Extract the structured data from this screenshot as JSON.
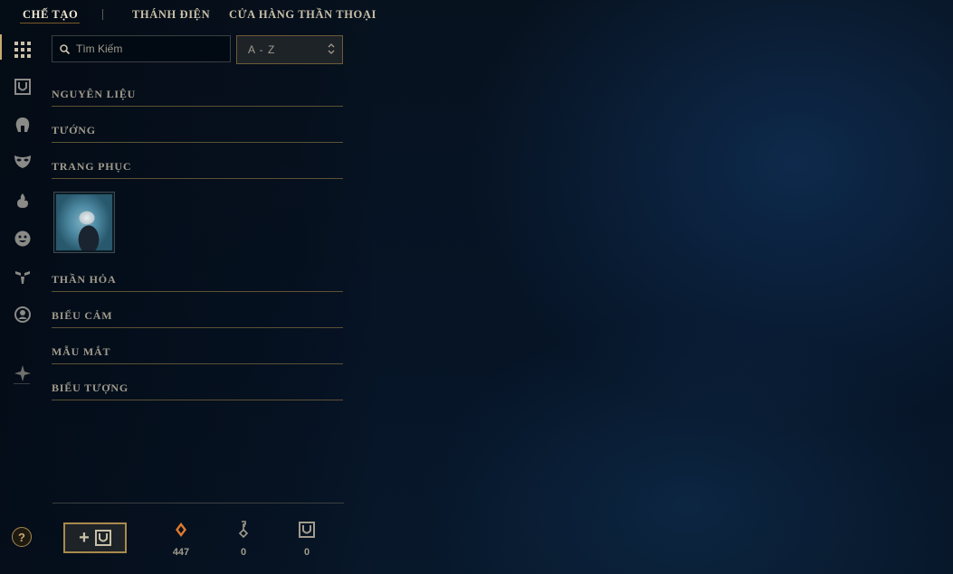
{
  "nav": {
    "tabs": [
      {
        "label": "CHẾ TẠO"
      },
      {
        "label": "THÁNH ĐIỆN"
      },
      {
        "label": "CỬA HÀNG THẦN THOẠI"
      }
    ]
  },
  "rail": {
    "icons": [
      "grid-icon",
      "chest-icon",
      "champion-helmet-icon",
      "skin-mask-icon",
      "ward-flame-icon",
      "emote-face-icon",
      "eternals-icon",
      "profile-icon",
      "summoner-icon"
    ]
  },
  "search": {
    "placeholder": "Tìm Kiếm",
    "value": ""
  },
  "sort": {
    "value": "A - Z"
  },
  "categories": [
    {
      "label": "NGUYÊN LIỆU"
    },
    {
      "label": "TƯỚNG"
    },
    {
      "label": "TRANG PHỤC"
    },
    {
      "label": "THẦN HỎA"
    },
    {
      "label": "BIỂU CẢM"
    },
    {
      "label": "MẪU MẮT"
    },
    {
      "label": "BIỂU TƯỢNG"
    }
  ],
  "bottom": {
    "help_label": "?",
    "add_label": "+",
    "currencies": [
      {
        "icon": "orange-essence-icon",
        "value": "447",
        "color": "#e07a2c"
      },
      {
        "icon": "key-fragment-icon",
        "value": "0",
        "color": "#a09b8c"
      },
      {
        "icon": "chest-icon",
        "value": "0",
        "color": "#a09b8c"
      }
    ]
  },
  "colors": {
    "gold": "#c8aa6e",
    "text_muted": "#a09b8c",
    "background": "#061120"
  }
}
